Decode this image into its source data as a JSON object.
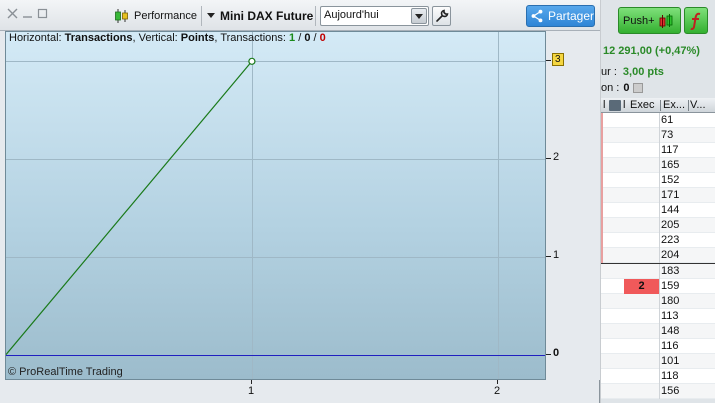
{
  "toolbar": {
    "performance_label": "Performance",
    "instrument_label": "Mini DAX Future",
    "period_value": "Aujourd'hui",
    "share_label": "Partager"
  },
  "chart_header": {
    "prefix_horizontal": "Horizontal: ",
    "horizontal_value": "Transactions",
    "prefix_vertical": ", Vertical: ",
    "vertical_value": "Points",
    "prefix_transactions": ", Transactions: ",
    "tx_win": "1",
    "tx_slash1": " / ",
    "tx_neutral": "0",
    "tx_slash2": " / ",
    "tx_loss": "0",
    "colors": {
      "win": "#1a8a1a",
      "neutral": "#111111",
      "loss": "#c00000"
    }
  },
  "copyright": "© ProRealTime Trading",
  "chart_data": {
    "type": "line",
    "xlabel": "",
    "ylabel": "",
    "x": [
      0,
      1
    ],
    "xlim": [
      0,
      2.2
    ],
    "ylim": [
      -0.27,
      3.3
    ],
    "x_ticks": [
      "1",
      "2"
    ],
    "y_ticks": [
      "0",
      "1",
      "2",
      "3"
    ],
    "grid": true,
    "series": [
      {
        "values": [
          0,
          3
        ],
        "color": "#1a7a1a"
      }
    ],
    "baseline": {
      "y": 0,
      "color": "#2020c0"
    },
    "last_value_badge": "3"
  },
  "right_panel": {
    "push_label": "Push+",
    "quote": "12 291,00 (+0,47%)",
    "row_ur_label": "ur :",
    "row_ur_value": "3,00 pts",
    "row_on_label": "on :",
    "row_on_value": "0",
    "headers": {
      "a": "l",
      "b": "l",
      "exec": "Exec",
      "ex": "Ex...",
      "v": "V..."
    },
    "rows_top": [
      "61",
      "73",
      "117",
      "165",
      "152",
      "171",
      "144",
      "205",
      "223",
      "204"
    ],
    "rows_bottom": [
      {
        "exec": "",
        "val": "183"
      },
      {
        "exec": "2",
        "val": "159"
      },
      {
        "exec": "",
        "val": "180"
      },
      {
        "exec": "",
        "val": "113"
      },
      {
        "exec": "",
        "val": "148"
      },
      {
        "exec": "",
        "val": "116"
      },
      {
        "exec": "",
        "val": "101"
      },
      {
        "exec": "",
        "val": "118"
      },
      {
        "exec": "",
        "val": "156"
      }
    ]
  }
}
